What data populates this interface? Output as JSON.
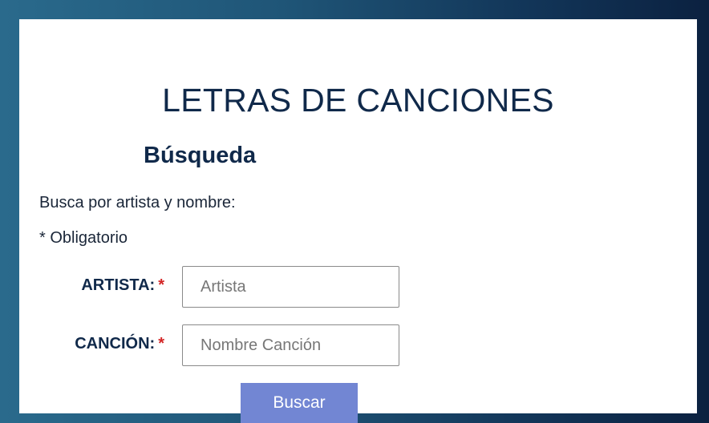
{
  "page": {
    "title": "LETRAS DE CANCIONES"
  },
  "search": {
    "heading": "Búsqueda",
    "instructions": "Busca por artista y nombre:",
    "required_note": "* Obligatorio",
    "required_marker": "*",
    "artist": {
      "label": "ARTISTA:",
      "placeholder": "Artista",
      "value": ""
    },
    "song": {
      "label": "CANCIÓN:",
      "placeholder": "Nombre Canción",
      "value": ""
    },
    "submit_label": "Buscar"
  },
  "colors": {
    "heading": "#10294a",
    "required": "#d32525",
    "button": "#7286d3",
    "background_start": "#2a6a8c",
    "background_end": "#0b2140"
  }
}
